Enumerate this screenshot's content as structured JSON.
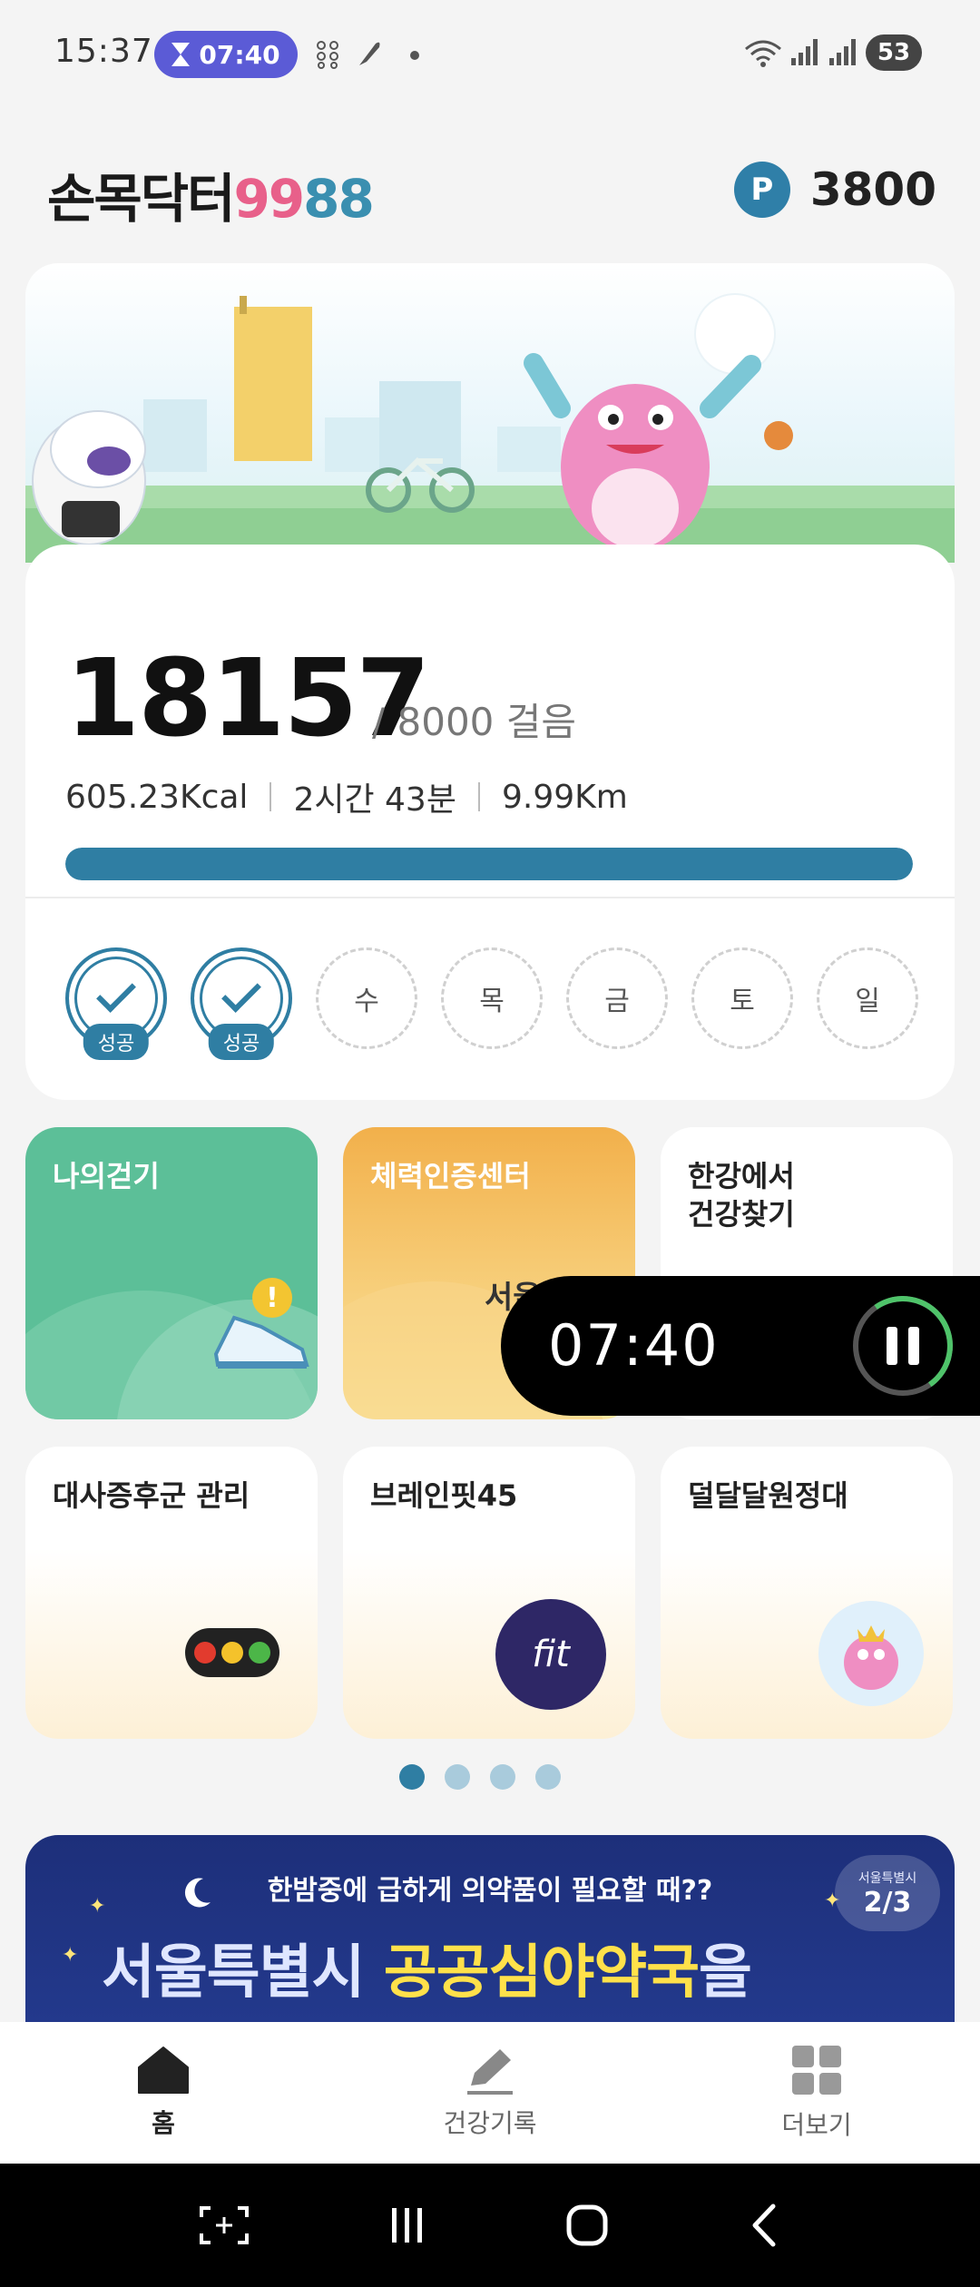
{
  "status_bar": {
    "time": "15:37",
    "timer_pill": "07:40",
    "battery": "53"
  },
  "header": {
    "logo_name": "손목닥터",
    "logo_num1": "99",
    "logo_num2": "88",
    "point_badge": "P",
    "points": "3800"
  },
  "steps": {
    "count": "18157",
    "goal": "/ 8000 걸음",
    "kcal": "605.23Kcal",
    "duration": "2시간 43분",
    "distance": "9.99Km",
    "progress": 1.0
  },
  "week": [
    {
      "label": "",
      "status": "success",
      "badge": "성공"
    },
    {
      "label": "",
      "status": "success",
      "badge": "성공"
    },
    {
      "label": "수",
      "status": "pending"
    },
    {
      "label": "목",
      "status": "pending"
    },
    {
      "label": "금",
      "status": "pending"
    },
    {
      "label": "토",
      "status": "pending"
    },
    {
      "label": "일",
      "status": "pending"
    }
  ],
  "tiles": {
    "t1": "나의걷기",
    "t2": "체력인증센터",
    "t3": "한강에서\n건강찾기",
    "t4": "대사증후군 관리",
    "t5": "브레인핏45",
    "t6": "덜달달원정대"
  },
  "tile_extras": {
    "t2_partial": "서울",
    "fit_logo": "fit"
  },
  "float_timer": {
    "time": "07:40"
  },
  "pagination": {
    "total": 4,
    "active": 1
  },
  "promo": {
    "subtitle": "한밤중에 급하게 의약품이 필요할 때??",
    "title_prefix": "서울특별시 ",
    "title_highlight": "공공심야약국",
    "title_suffix": "을",
    "page_org": "서울특별시",
    "page": "2/3"
  },
  "bottom_nav": {
    "home": "홈",
    "health_record": "건강기록",
    "more": "더보기"
  },
  "colors": {
    "accent": "#2f7ea3",
    "timer_pill": "#5b5bd6",
    "logo_pink": "#e8608a",
    "logo_teal": "#3a8fb0",
    "walk_tile": "#5cbf98",
    "fitness_tile": "#f2b04b",
    "promo_bg": "#1d2f7a",
    "promo_highlight": "#ffe14a"
  },
  "icons": [
    "hourglass-icon",
    "wifi-icon",
    "signal-icon",
    "home-icon",
    "pencil-icon",
    "grid-icon",
    "check-icon",
    "pause-icon",
    "recents-icon",
    "back-icon"
  ]
}
